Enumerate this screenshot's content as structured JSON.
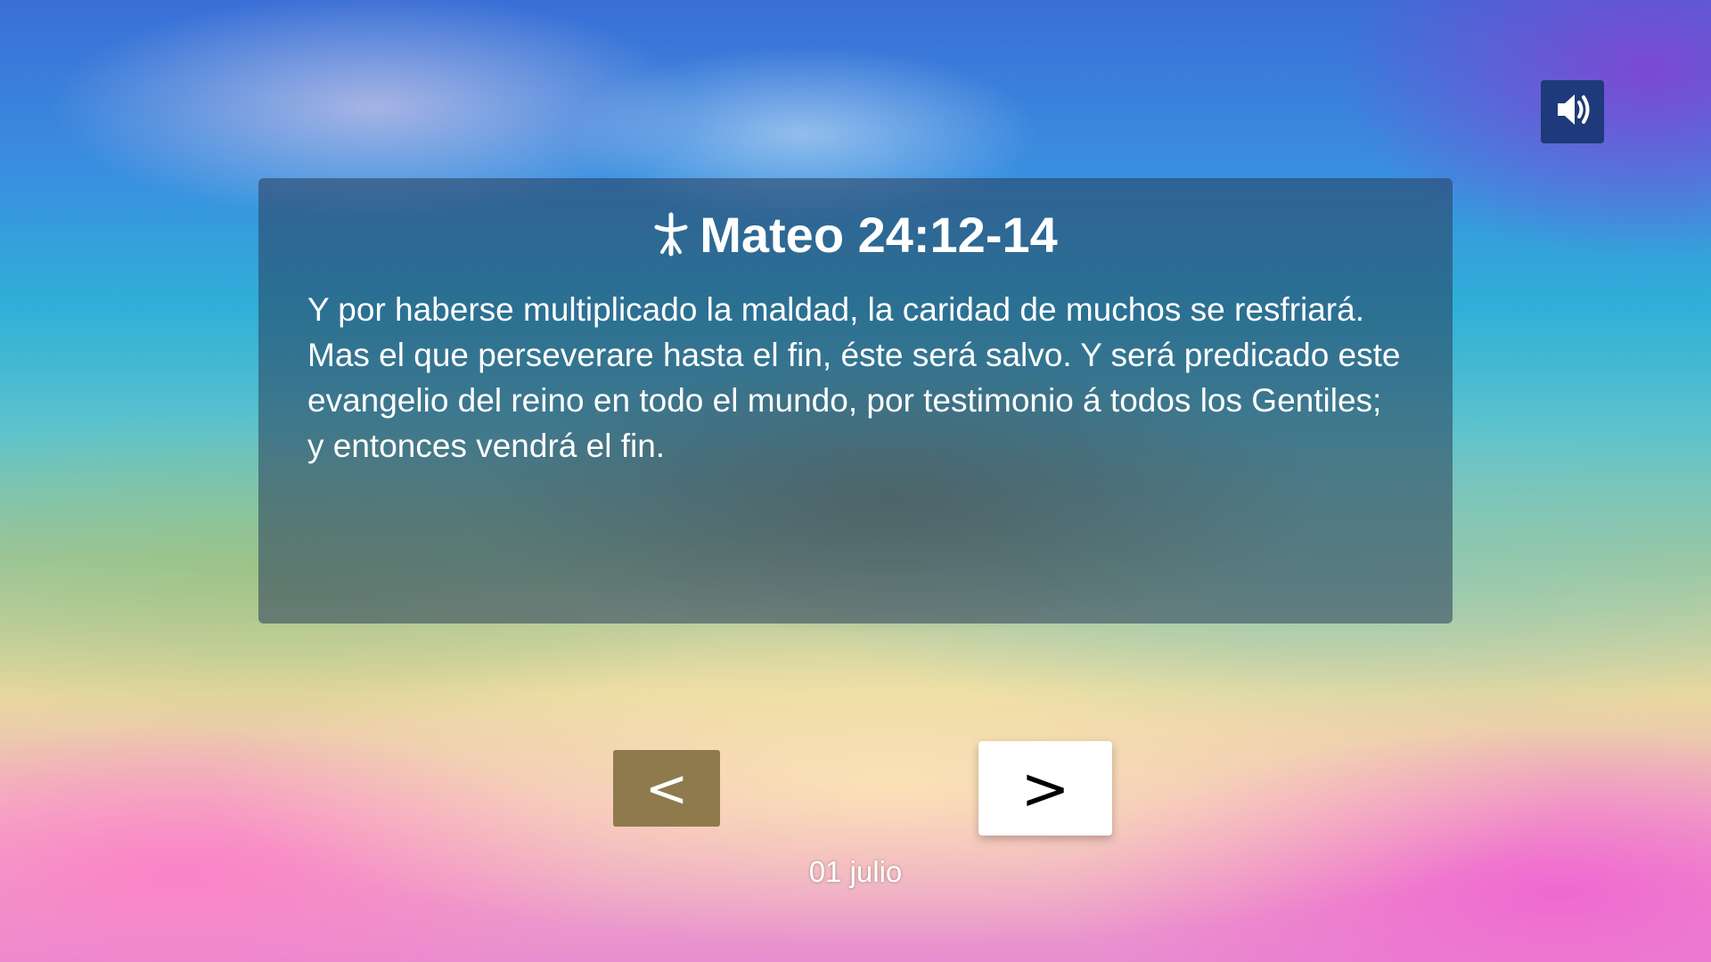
{
  "background": {
    "description_colors": [
      "#3a6fd6",
      "#2fb0d8",
      "#e8d8a0",
      "#e88ed0"
    ]
  },
  "sound_button": {
    "icon": "speaker-volume-icon",
    "color": "#1f3a7a"
  },
  "panel": {
    "title": "Mateo 24:12-14",
    "icon": "cross-icon",
    "verse": "Y por haberse multiplicado la maldad, la caridad de muchos se resfriará. Mas el que perseverare hasta el fin, éste será salvo. Y será predicado este evangelio del reino en todo el mundo, por testimonio á todos los Gentiles; y entonces vendrá el fin."
  },
  "navigation": {
    "prev_label": "<",
    "next_label": ">",
    "prev_color": "#8f7a4e",
    "next_color": "#ffffff"
  },
  "date": "01 julio"
}
